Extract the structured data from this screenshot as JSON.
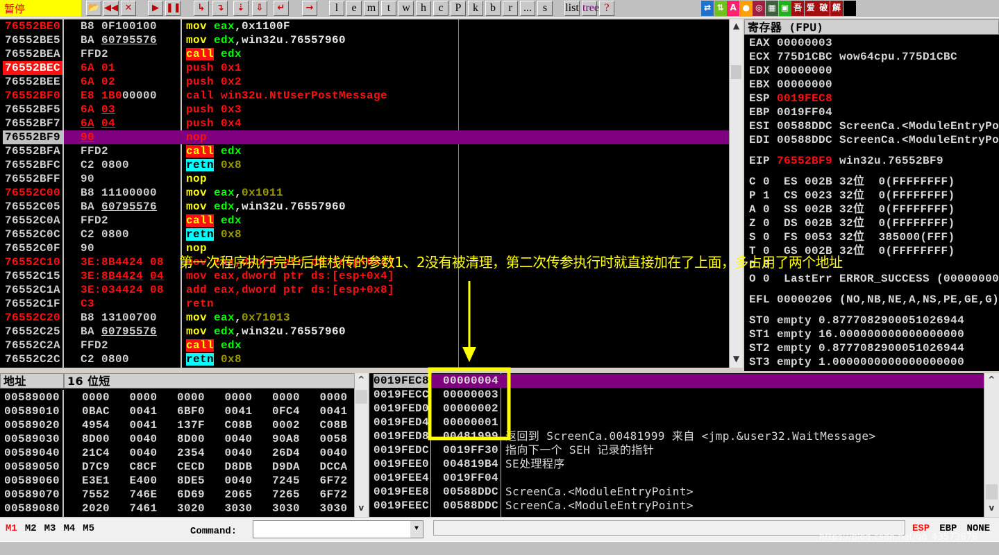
{
  "toolbar": {
    "status": "暂停",
    "buttons": [
      "open",
      "rewind",
      "close",
      "run",
      "pause",
      "step-into",
      "step-over",
      "trace-into",
      "trace-over",
      "execute-till-return",
      "go-to"
    ],
    "letters": [
      "l",
      "e",
      "m",
      "t",
      "w",
      "h",
      "c",
      "P",
      "k",
      "b",
      "r",
      "...",
      "s"
    ],
    "right_icons": [
      "list",
      "tree",
      "?"
    ],
    "plugins": [
      "⇄",
      "⇅",
      "A",
      "●",
      "◎",
      "▦",
      "▣",
      "吾",
      "爱",
      "破",
      "解",
      ""
    ]
  },
  "disasm": {
    "rows": [
      {
        "addr": "76552BE0",
        "ac": "red",
        "hex": [
          [
            "B8 0F100100",
            "gry"
          ]
        ],
        "ins": [
          [
            "mov ",
            "yel"
          ],
          [
            "eax",
            "grn"
          ],
          [
            ",0x1100F",
            "wht"
          ]
        ]
      },
      {
        "addr": "76552BE5",
        "ac": "gry",
        "hex": [
          [
            "BA ",
            "gry"
          ],
          [
            "60795576",
            "gry ul"
          ]
        ],
        "ins": [
          [
            "mov ",
            "yel"
          ],
          [
            "edx",
            "grn"
          ],
          [
            ",win32u.76557960",
            "wht"
          ]
        ]
      },
      {
        "addr": "76552BEA",
        "ac": "gry",
        "hex": [
          [
            "FFD2",
            "gry"
          ]
        ],
        "ins": [
          [
            "call",
            "callbg"
          ],
          [
            " edx",
            "grn"
          ]
        ]
      },
      {
        "addr": "76552BEC",
        "ac": "bp",
        "hex": [
          [
            "6A 01",
            "red"
          ]
        ],
        "ins": [
          [
            "push 0x1",
            "red"
          ]
        ]
      },
      {
        "addr": "76552BEE",
        "ac": "gry",
        "hex": [
          [
            "6A 02",
            "red"
          ]
        ],
        "ins": [
          [
            "push 0x2",
            "red"
          ]
        ]
      },
      {
        "addr": "76552BF0",
        "ac": "red",
        "hex": [
          [
            "E8 1B0",
            "red"
          ],
          [
            "00000",
            "gry"
          ]
        ],
        "ins": [
          [
            "call win32u.NtUserPostMessage",
            "red"
          ]
        ]
      },
      {
        "addr": "76552BF5",
        "ac": "gry",
        "hex": [
          [
            "6A ",
            "red"
          ],
          [
            "03",
            "red ul"
          ]
        ],
        "ins": [
          [
            "push 0x3",
            "red"
          ]
        ]
      },
      {
        "addr": "76552BF7",
        "ac": "gry",
        "hex": [
          [
            "6A",
            "red ul"
          ],
          [
            " ",
            "red"
          ],
          [
            "04",
            "red ul"
          ]
        ],
        "ins": [
          [
            "push 0x4",
            "red"
          ]
        ]
      },
      {
        "addr": "76552BF9",
        "ac": "sel",
        "hex": [
          [
            "90",
            "red ul"
          ]
        ],
        "ins": [
          [
            "nop",
            "red"
          ]
        ],
        "selected": true
      },
      {
        "addr": "76552BFA",
        "ac": "gry",
        "hex": [
          [
            "FFD2",
            "gry"
          ]
        ],
        "ins": [
          [
            "call",
            "callbg"
          ],
          [
            " edx",
            "grn"
          ]
        ]
      },
      {
        "addr": "76552BFC",
        "ac": "gry",
        "hex": [
          [
            "C2 0800",
            "gry"
          ]
        ],
        "ins": [
          [
            "retn",
            "retnbg"
          ],
          [
            " 0x8",
            "olv"
          ]
        ]
      },
      {
        "addr": "76552BFF",
        "ac": "gry",
        "hex": [
          [
            "90",
            "gry"
          ]
        ],
        "ins": [
          [
            "nop",
            "yel"
          ]
        ]
      },
      {
        "addr": "76552C00",
        "ac": "red",
        "hex": [
          [
            "B8 11100000",
            "gry"
          ]
        ],
        "ins": [
          [
            "mov ",
            "yel"
          ],
          [
            "eax",
            "grn"
          ],
          [
            ",",
            "wht"
          ],
          [
            "0x1011",
            "olv"
          ]
        ]
      },
      {
        "addr": "76552C05",
        "ac": "gry",
        "hex": [
          [
            "BA ",
            "gry"
          ],
          [
            "60795576",
            "gry ul"
          ]
        ],
        "ins": [
          [
            "mov ",
            "yel"
          ],
          [
            "edx",
            "grn"
          ],
          [
            ",win32u.76557960",
            "wht"
          ]
        ]
      },
      {
        "addr": "76552C0A",
        "ac": "gry",
        "hex": [
          [
            "FFD2",
            "gry"
          ]
        ],
        "ins": [
          [
            "call",
            "callbg"
          ],
          [
            " edx",
            "grn"
          ]
        ]
      },
      {
        "addr": "76552C0C",
        "ac": "gry",
        "hex": [
          [
            "C2 0800",
            "gry"
          ]
        ],
        "ins": [
          [
            "retn",
            "retnbg"
          ],
          [
            " 0x8",
            "olv"
          ]
        ]
      },
      {
        "addr": "76552C0F",
        "ac": "gry",
        "hex": [
          [
            "90",
            "gry"
          ]
        ],
        "ins": [
          [
            "nop",
            "yel"
          ]
        ]
      },
      {
        "addr": "76552C10",
        "ac": "red",
        "hex": [
          [
            "3E:8B4424 08",
            "red"
          ]
        ],
        "ins": [
          [
            "mov eax,dword ptr ds:[esp+0x8]",
            "red"
          ]
        ]
      },
      {
        "addr": "76552C15",
        "ac": "gry",
        "hex": [
          [
            "3E:",
            "red"
          ],
          [
            "8B4424",
            "red ul"
          ],
          [
            " ",
            "red"
          ],
          [
            "04",
            "red ul"
          ]
        ],
        "ins": [
          [
            "mov eax,dword ptr ds:[esp+0x4]",
            "red"
          ]
        ]
      },
      {
        "addr": "76552C1A",
        "ac": "gry",
        "hex": [
          [
            "3E:034424 08",
            "red"
          ]
        ],
        "ins": [
          [
            "add eax,dword ptr ds:[esp+0x8]",
            "red"
          ]
        ]
      },
      {
        "addr": "76552C1F",
        "ac": "gry",
        "hex": [
          [
            "C3",
            "red"
          ]
        ],
        "ins": [
          [
            "retn",
            "red"
          ]
        ]
      },
      {
        "addr": "76552C20",
        "ac": "red",
        "hex": [
          [
            "B8 13100700",
            "gry"
          ]
        ],
        "ins": [
          [
            "mov ",
            "yel"
          ],
          [
            "eax",
            "grn"
          ],
          [
            ",",
            "wht"
          ],
          [
            "0x71013",
            "olv"
          ]
        ]
      },
      {
        "addr": "76552C25",
        "ac": "gry",
        "hex": [
          [
            "BA ",
            "gry"
          ],
          [
            "60795576",
            "gry ul"
          ]
        ],
        "ins": [
          [
            "mov ",
            "yel"
          ],
          [
            "edx",
            "grn"
          ],
          [
            ",win32u.76557960",
            "wht"
          ]
        ]
      },
      {
        "addr": "76552C2A",
        "ac": "gry",
        "hex": [
          [
            "FFD2",
            "gry"
          ]
        ],
        "ins": [
          [
            "call",
            "callbg"
          ],
          [
            " edx",
            "grn"
          ]
        ]
      },
      {
        "addr": "76552C2C",
        "ac": "gry",
        "hex": [
          [
            "C2 0800",
            "gry"
          ]
        ],
        "ins": [
          [
            "retn",
            "retnbg"
          ],
          [
            " 0x8",
            "olv"
          ]
        ]
      }
    ]
  },
  "registers": {
    "title": "寄存器 (FPU)",
    "groups": [
      [
        [
          "EAX ",
          "00000003",
          ""
        ],
        [
          "ECX ",
          "775D1CBC",
          " wow64cpu.775D1CBC"
        ],
        [
          "EDX ",
          "00000000",
          ""
        ],
        [
          "EBX ",
          "00000000",
          ""
        ],
        [
          "ESP ",
          "0019FEC8",
          "",
          "red"
        ],
        [
          "EBP ",
          "0019FF04",
          ""
        ],
        [
          "ESI ",
          "00588DDC",
          " ScreenCa.<ModuleEntryPoint>"
        ],
        [
          "EDI ",
          "00588DDC",
          " ScreenCa.<ModuleEntryPoint>"
        ]
      ],
      [
        [
          "EIP ",
          "76552BF9",
          " win32u.76552BF9",
          "red"
        ]
      ],
      [
        [
          "C 0  ES ",
          "002B",
          " 32位  0(FFFFFFFF)"
        ],
        [
          "P 1  CS ",
          "0023",
          " 32位  0(FFFFFFFF)"
        ],
        [
          "A 0  SS ",
          "002B",
          " 32位  0(FFFFFFFF)"
        ],
        [
          "Z 0  DS ",
          "002B",
          " 32位  0(FFFFFFFF)"
        ],
        [
          "S 0  FS ",
          "0053",
          " 32位  385000(FFF)"
        ],
        [
          "T 0  GS ",
          "002B",
          " 32位  0(FFFFFFFF)"
        ],
        [
          "D 0",
          "",
          " "
        ],
        [
          "O 0  ",
          "LastErr",
          " ERROR_SUCCESS (00000000)"
        ]
      ],
      [
        [
          "EFL ",
          "00000206",
          " (NO,NB,NE,A,NS,PE,GE,G)"
        ]
      ],
      [
        [
          "ST0 ",
          "empty",
          " 0.8777082900051026944"
        ],
        [
          "ST1 ",
          "empty",
          " 16.000000000000000000"
        ],
        [
          "ST2 ",
          "empty",
          " 0.8777082900051026944"
        ],
        [
          "ST3 ",
          "empty",
          " 1.0000000000000000000"
        ]
      ]
    ]
  },
  "dump": {
    "col_addr": "地址",
    "col_data": "16 位短",
    "rows": [
      [
        "00589000",
        "0000",
        "0000",
        "0000",
        "0000",
        "0000",
        "0000"
      ],
      [
        "00589010",
        "0BAC",
        "0041",
        "6BF0",
        "0041",
        "0FC4",
        "0041"
      ],
      [
        "00589020",
        "4954",
        "0041",
        "137F",
        "C08B",
        "0002",
        "C08B"
      ],
      [
        "00589030",
        "8D00",
        "0040",
        "8D00",
        "0040",
        "90A8",
        "0058"
      ],
      [
        "00589040",
        "21C4",
        "0040",
        "2354",
        "0040",
        "26D4",
        "0040"
      ],
      [
        "00589050",
        "D7C9",
        "C8CF",
        "CECD",
        "D8DB",
        "D9DA",
        "DCCA"
      ],
      [
        "00589060",
        "E3E1",
        "E400",
        "8DE5",
        "0040",
        "7245",
        "6F72"
      ],
      [
        "00589070",
        "7552",
        "746E",
        "6D69",
        "2065",
        "7265",
        "6F72"
      ],
      [
        "00589080",
        "2020",
        "7461",
        "3020",
        "3030",
        "3030",
        "3030"
      ]
    ]
  },
  "stack": {
    "rows": [
      [
        "0019FEC8",
        "00000004",
        ""
      ],
      [
        "0019FECC",
        "00000003",
        ""
      ],
      [
        "0019FED0",
        "00000002",
        ""
      ],
      [
        "0019FED4",
        "00000001",
        ""
      ],
      [
        "0019FED8",
        "00481999",
        "返回到 ScreenCa.00481999 来自 <jmp.&user32.WaitMessage>"
      ],
      [
        "0019FEDC",
        "0019FF30",
        "指向下一个 SEH 记录的指针"
      ],
      [
        "0019FEE0",
        "004819B4",
        "SE处理程序"
      ],
      [
        "0019FEE4",
        "0019FF04",
        ""
      ],
      [
        "0019FEE8",
        "00588DDC",
        "ScreenCa.<ModuleEntryPoint>"
      ],
      [
        "0019FEEC",
        "00588DDC",
        "ScreenCa.<ModuleEntryPoint>"
      ]
    ]
  },
  "bottom": {
    "marks": [
      "M1",
      "M2",
      "M3",
      "M4",
      "M5"
    ],
    "command_label": "Command:",
    "command_value": "",
    "right": [
      "ESP",
      "EBP",
      "NONE"
    ]
  },
  "annotation": "第一次程序执行完毕后堆栈传的参数1、2没有被清理，第二次传参执行时就直接加在了上面，多占用了两个地址",
  "watermark": "https://blog.csdn.net/qq_43573676",
  "colors": {
    "highlight": "#800080",
    "annotation": "#ffff00",
    "accent_red": "#ff1010"
  }
}
